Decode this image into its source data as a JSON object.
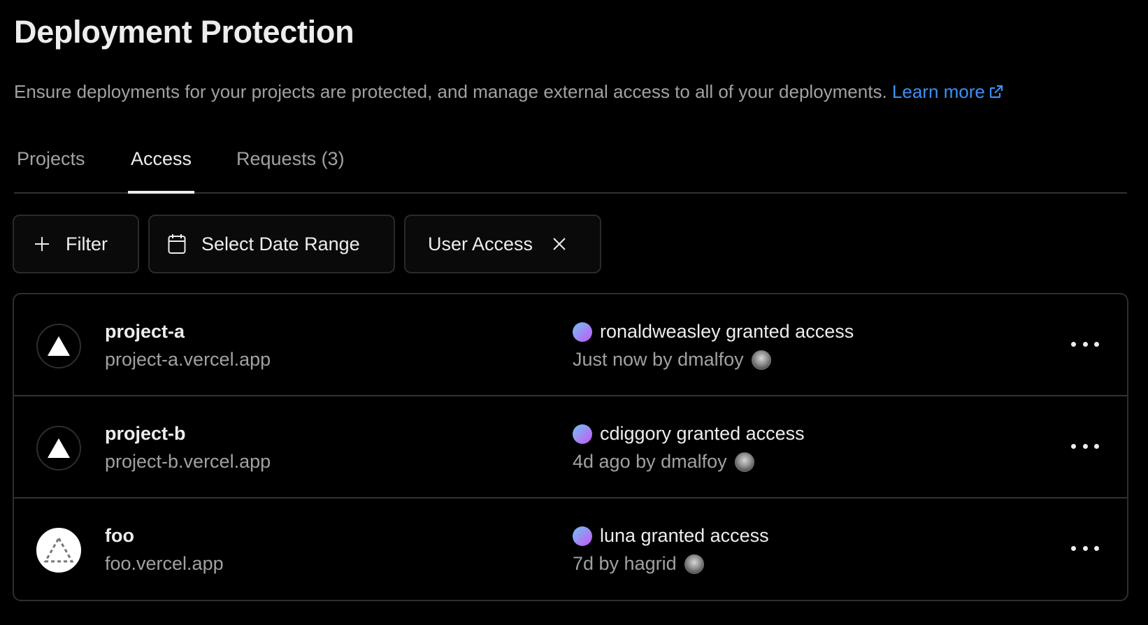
{
  "page": {
    "title": "Deployment Protection",
    "description": "Ensure deployments for your projects are protected, and manage external access to all of your deployments.",
    "learn_more": "Learn more",
    "link_color": "#3b91f5"
  },
  "tabs": [
    {
      "label": "Projects",
      "active": false
    },
    {
      "label": "Access",
      "active": true
    },
    {
      "label": "Requests (3)",
      "active": false
    }
  ],
  "toolbar": {
    "filter_label": "Filter",
    "date_range_label": "Select Date Range",
    "active_filter_label": "User Access"
  },
  "rows": [
    {
      "project_name": "project-a",
      "project_url": "project-a.vercel.app",
      "icon": "vercel-triangle-icon",
      "action": "ronaldweasley granted access",
      "meta": "Just now by dmalfoy"
    },
    {
      "project_name": "project-b",
      "project_url": "project-b.vercel.app",
      "icon": "vercel-triangle-icon",
      "action": "cdiggory granted access",
      "meta": "4d ago by dmalfoy"
    },
    {
      "project_name": "foo",
      "project_url": "foo.vercel.app",
      "icon": "dashed-triangle-icon",
      "action": "luna granted access",
      "meta": "7d by hagrid"
    }
  ]
}
